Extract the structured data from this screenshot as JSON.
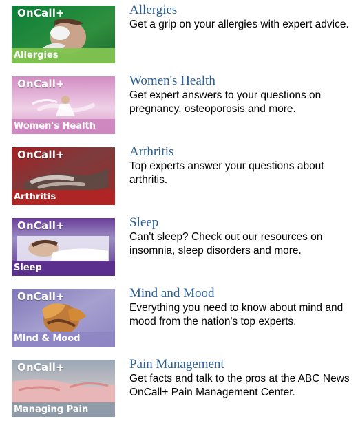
{
  "items": [
    {
      "brand": "OnCall+",
      "category": "Allergies",
      "title": "Allergies",
      "description": "Get a grip on your allergies with expert advice.",
      "icon": "allergies-thumbnail-icon",
      "colors": {
        "top": "#0c8a3c",
        "mid": "#5aa64c",
        "band": "#83c451"
      }
    },
    {
      "brand": "OnCall+",
      "category": "Women's Health",
      "title": "Women's Health",
      "description": "Get expert answers to your questions on pregnancy, osteoporosis and more.",
      "icon": "womens-health-thumbnail-icon",
      "colors": {
        "top": "#c879b6",
        "mid": "#e8bfdc",
        "band": "#d48fc4"
      }
    },
    {
      "brand": "OnCall+",
      "category": "Arthritis",
      "title": "Arthritis",
      "description": "Top experts answer your questions about arthritis.",
      "icon": "arthritis-thumbnail-icon",
      "colors": {
        "top": "#a31f23",
        "mid": "#8c4a4a",
        "band": "#b02525"
      }
    },
    {
      "brand": "OnCall+",
      "category": "Sleep",
      "title": "Sleep",
      "description": "Can't sleep? Check out our resources on insomnia, sleep disorders and more.",
      "icon": "sleep-thumbnail-icon",
      "colors": {
        "top": "#6a3d99",
        "mid": "#b9b2d6",
        "band": "#5a2e8c"
      }
    },
    {
      "brand": "OnCall+",
      "category": "Mind & Mood",
      "title": "Mind and Mood",
      "description": "Everything you need to know about mind and mood from the nation's top experts.",
      "icon": "mind-and-mood-thumbnail-icon",
      "colors": {
        "top": "#7f77b8",
        "mid": "#d98a2b",
        "band": "#8e86c4"
      }
    },
    {
      "brand": "OnCall+",
      "category": "Managing Pain",
      "title": "Pain Management",
      "description": "Get facts and talk to the pros at the ABC News OnCall+ Pain Management Center.",
      "icon": "managing-pain-thumbnail-icon",
      "colors": {
        "top": "#9aa7b5",
        "mid": "#e6b9b9",
        "band": "#8e9aa8"
      }
    }
  ]
}
